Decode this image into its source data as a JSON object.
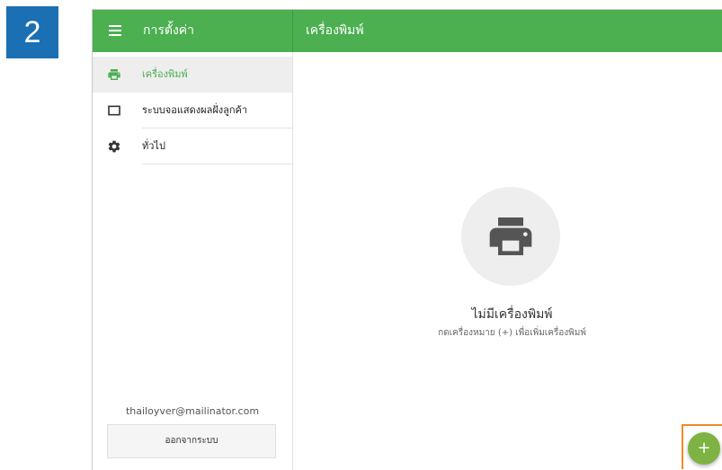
{
  "step_badge": "2",
  "appbar": {
    "title": "การตั้งค่า",
    "section_title": "เครื่องพิมพ์",
    "color": "#4caf50"
  },
  "sidebar": {
    "items": [
      {
        "label": "เครื่องพิมพ์",
        "icon": "printer-icon",
        "active": true
      },
      {
        "label": "ระบบจอแสดงผลฝั่งลูกค้า",
        "icon": "display-icon",
        "active": false
      },
      {
        "label": "ทั่วไป",
        "icon": "gear-icon",
        "active": false
      }
    ],
    "user_email": "thailoyver@mailinator.com",
    "logout_label": "ออกจากระบบ"
  },
  "main": {
    "empty_icon": "printer-icon",
    "empty_title": "ไม่มีเครื่องพิมพ์",
    "empty_hint": "กดเครื่องหมาย (+) เพื่อเพิ่มเครื่องพิมพ์"
  },
  "fab": {
    "label": "+",
    "color": "#7cb342",
    "highlight_color": "#f08a24"
  }
}
